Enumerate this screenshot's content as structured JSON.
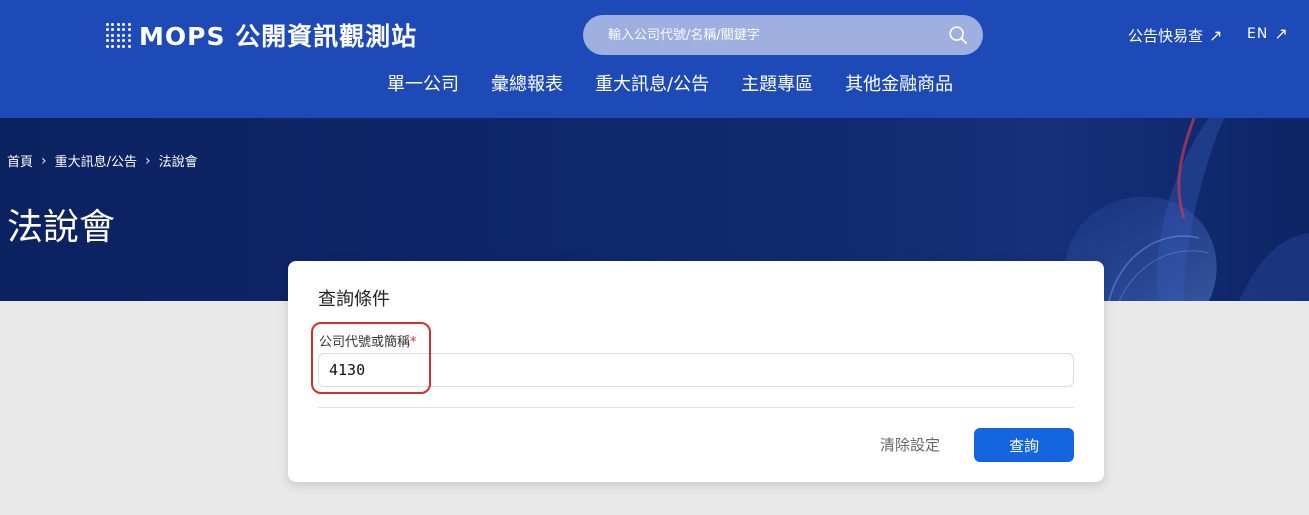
{
  "header": {
    "logo_text": "MOPS 公開資訊觀測站",
    "search_placeholder": "輸入公司代號/名稱/關鍵字",
    "quick_link": "公告快易查",
    "lang": "EN",
    "nav": [
      "單一公司",
      "彙總報表",
      "重大訊息/公告",
      "主題專區",
      "其他金融商品"
    ]
  },
  "breadcrumb": [
    "首頁",
    "重大訊息/公告",
    "法說會"
  ],
  "page_title": "法說會",
  "form": {
    "title": "查詢條件",
    "field_label": "公司代號或簡稱",
    "required_mark": "*",
    "field_value": "4130",
    "clear_label": "清除設定",
    "query_label": "查詢"
  },
  "colors": {
    "header_bg": "#1e4ab8",
    "banner_bg": "#0c2160",
    "primary_button": "#1565e0",
    "highlight": "#d32f2f"
  }
}
